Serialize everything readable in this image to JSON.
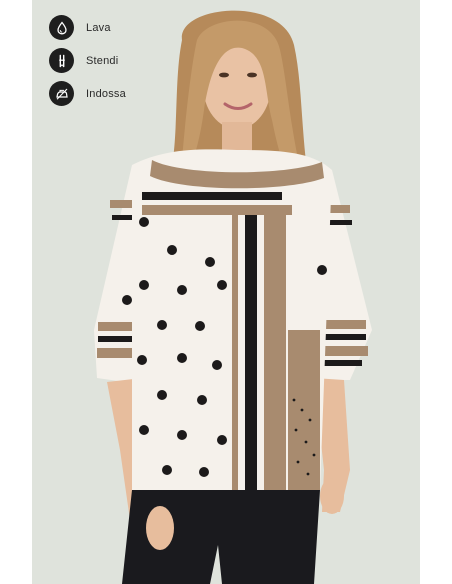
{
  "care_instructions": [
    {
      "icon": "wash-water-drop-icon",
      "label": "Lava"
    },
    {
      "icon": "hang-dry-clothespin-icon",
      "label": "Stendi"
    },
    {
      "icon": "iron-icon",
      "label": "Indossa"
    }
  ],
  "product_image": {
    "alt": "",
    "background_color": "#dfe3dc",
    "print_colors": [
      "#f5f1eb",
      "#a88b6f",
      "#1c1a1a"
    ]
  }
}
